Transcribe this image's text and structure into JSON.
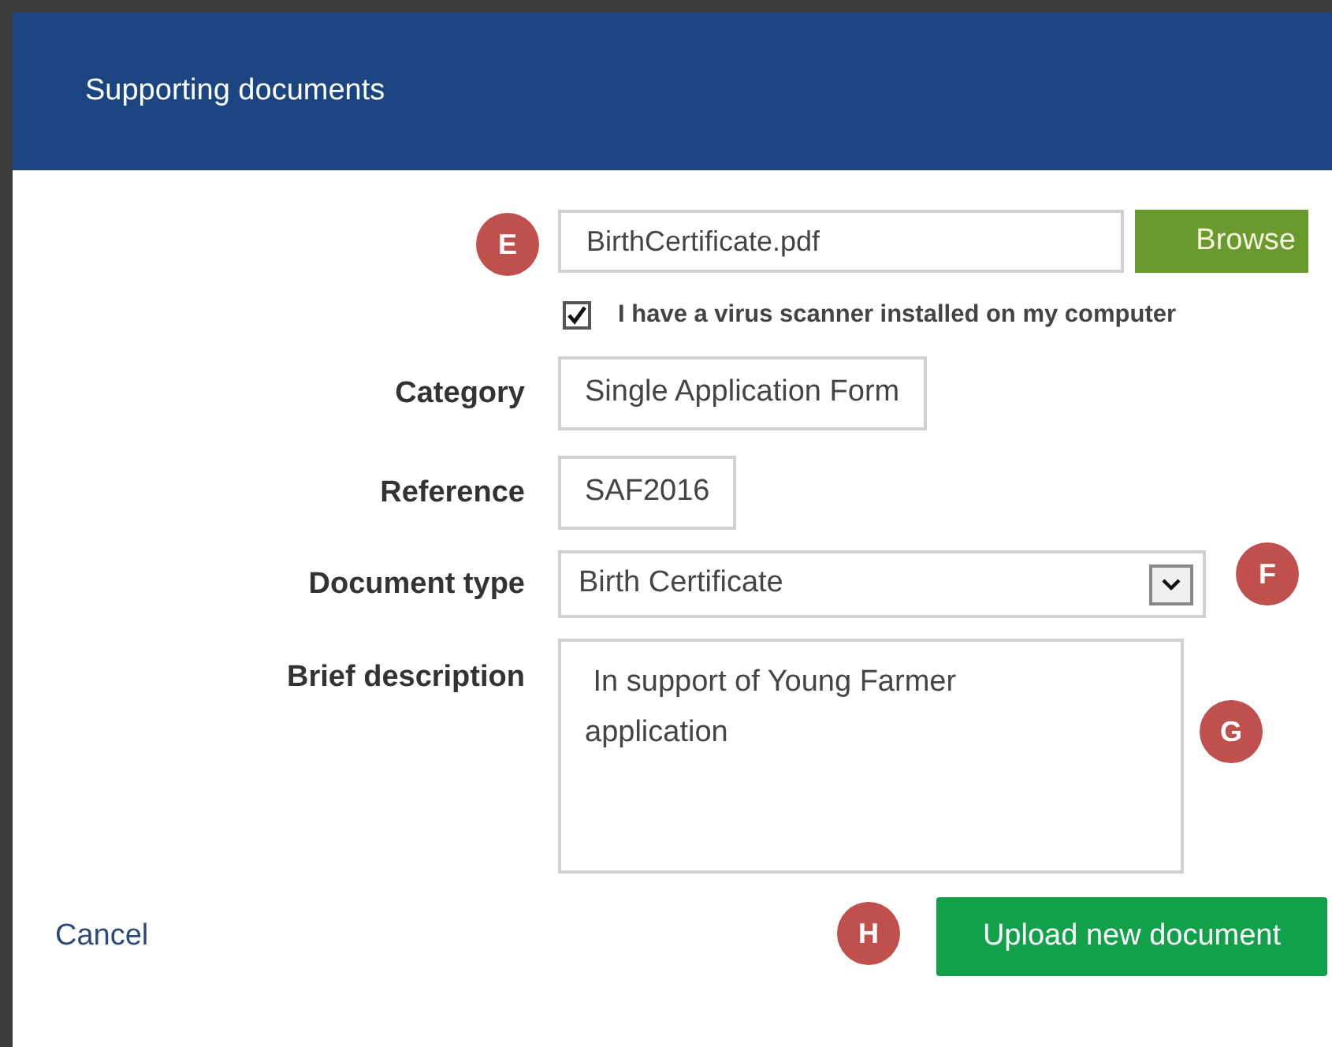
{
  "dialog": {
    "title": "Supporting documents"
  },
  "file": {
    "value": "BirthCertificate.pdf",
    "button": "Browse",
    "marker": "E"
  },
  "virus_check": {
    "label": "I have a virus scanner installed on my computer",
    "checked": true
  },
  "fields": [
    {
      "kind": "text",
      "label": "Category",
      "value": "Single Application Form"
    },
    {
      "kind": "text",
      "label": "Reference",
      "value": "SAF2016"
    },
    {
      "kind": "select",
      "label": "Document type",
      "value": "Birth Certificate",
      "marker": "F"
    },
    {
      "kind": "textarea",
      "label": "Brief description",
      "value": " In support of Young Farmer application",
      "marker": "G"
    }
  ],
  "actions": {
    "cancel": "Cancel",
    "submit": "Upload new document",
    "marker": "H"
  }
}
